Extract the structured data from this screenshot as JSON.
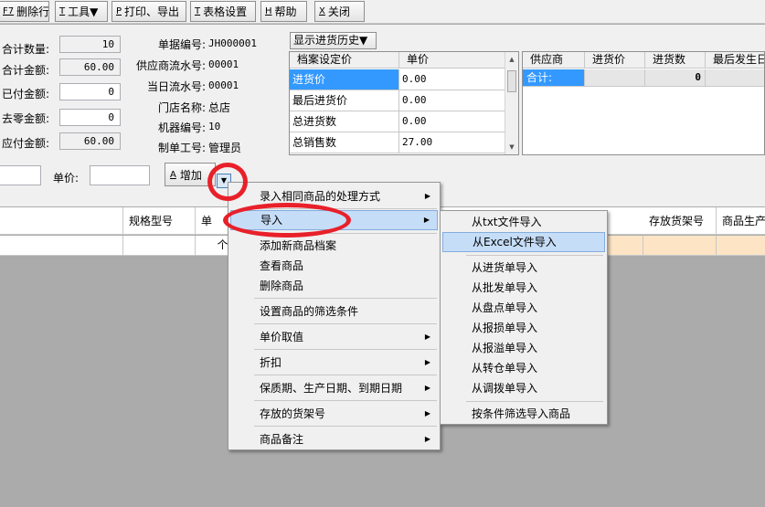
{
  "toolbar": {
    "buttons": [
      {
        "hotkey": "F7",
        "label": "删除行"
      },
      {
        "hotkey": "T",
        "label": "工具▼"
      },
      {
        "hotkey": "P",
        "label": "打印、导出"
      },
      {
        "hotkey": "T",
        "label": "表格设置"
      },
      {
        "hotkey": "H",
        "label": "帮助"
      },
      {
        "hotkey": "X",
        "label": "关闭"
      }
    ]
  },
  "summary": {
    "total_qty_label": "合计数量:",
    "total_qty": "10",
    "total_amount_label": "合计金额:",
    "total_amount": "60.00",
    "paid_label": "已付金额:",
    "paid": "0",
    "rounding_label": "去零金额:",
    "rounding": "0",
    "payable_label": "应付金额:",
    "payable": "60.00"
  },
  "doc": {
    "doc_no_label": "单据编号:",
    "doc_no": "JH000001",
    "supplier_serial_label": "供应商流水号:",
    "supplier_serial": "00001",
    "daily_serial_label": "当日流水号:",
    "daily_serial": "00001",
    "store_label": "门店名称:",
    "store": "总店",
    "machine_label": "机器编号:",
    "machine": "10",
    "maker_label": "制单工号:",
    "maker": "管理员"
  },
  "history_button": "显示进货历史▼",
  "price_grid": {
    "headers": [
      "档案设定价",
      "单价"
    ],
    "rows": [
      {
        "name": "进货价",
        "value": "0.00"
      },
      {
        "name": "最后进货价",
        "value": "0.00"
      },
      {
        "name": "总进货数",
        "value": "0.00"
      },
      {
        "name": "总销售数",
        "value": "27.00"
      }
    ]
  },
  "supplier_grid": {
    "headers": [
      "供应商",
      "进货价",
      "进货数",
      "最后发生日"
    ],
    "total_label": "合计:",
    "total_qty": "0"
  },
  "entry": {
    "unit_price_label": "单价:",
    "add_hotkey": "A",
    "add_label": "增加"
  },
  "main_grid": {
    "headers": [
      "规格型号",
      "单",
      "存放货架号",
      "商品生产"
    ],
    "row_unit": "个"
  },
  "context_menu": {
    "items": [
      {
        "label": "录入相同商品的处理方式",
        "submenu": true
      },
      {
        "label": "导入",
        "submenu": true
      },
      {
        "label": "添加新商品档案",
        "submenu": false
      },
      {
        "label": "查看商品",
        "submenu": false
      },
      {
        "label": "删除商品",
        "submenu": false
      },
      {
        "label": "设置商品的筛选条件",
        "submenu": false
      },
      {
        "label": "单价取值",
        "submenu": true
      },
      {
        "label": "折扣",
        "submenu": true
      },
      {
        "label": "保质期、生产日期、到期日期",
        "submenu": true
      },
      {
        "label": "存放的货架号",
        "submenu": true
      },
      {
        "label": "商品备注",
        "submenu": true
      }
    ]
  },
  "import_submenu": {
    "items": [
      "从txt文件导入",
      "从Excel文件导入",
      "从进货单导入",
      "从批发单导入",
      "从盘点单导入",
      "从报损单导入",
      "从报溢单导入",
      "从转仓单导入",
      "从调拨单导入",
      "按条件筛选导入商品"
    ]
  },
  "colors": {
    "selection": "#3399ff",
    "menu_highlight": "#c6ddf7",
    "row_highlight": "#fce4c4",
    "annotation_red": "#e8202a"
  }
}
